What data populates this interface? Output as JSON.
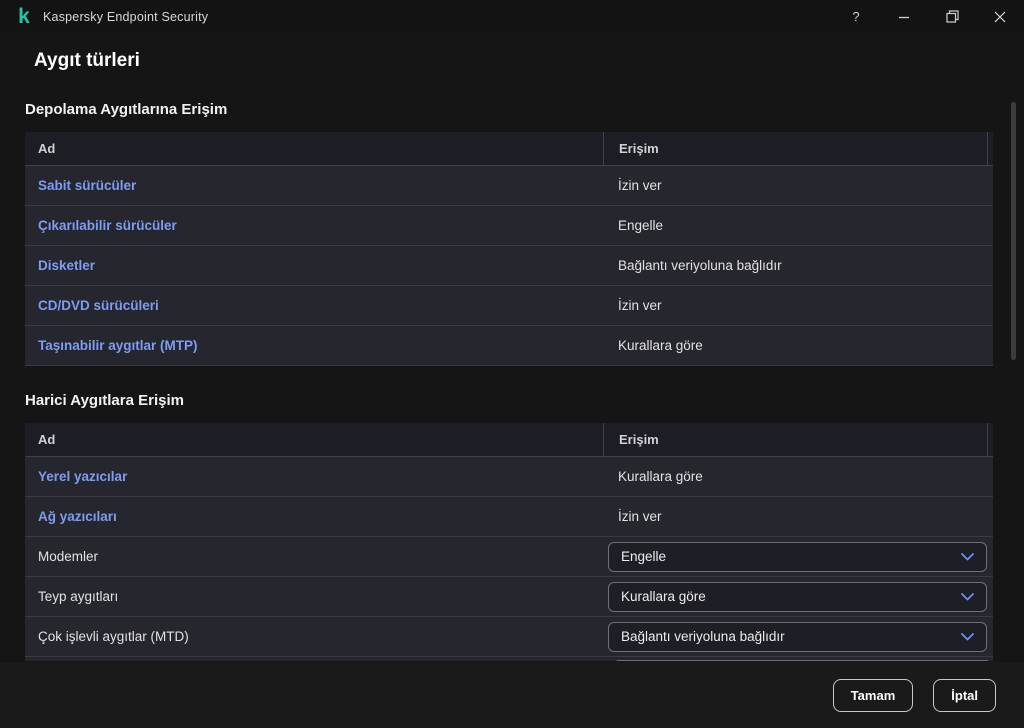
{
  "window": {
    "title": "Kaspersky Endpoint Security",
    "help_label": "?"
  },
  "page": {
    "title": "Aygıt türleri"
  },
  "sections": [
    {
      "heading": "Depolama Aygıtlarına Erişim",
      "columns": [
        "Ad",
        "Erişim"
      ],
      "rows": [
        {
          "name": "Sabit sürücüler",
          "access": "İzin ver",
          "name_is_link": true,
          "access_control": "text"
        },
        {
          "name": "Çıkarılabilir sürücüler",
          "access": "Engelle",
          "name_is_link": true,
          "access_control": "text"
        },
        {
          "name": "Disketler",
          "access": "Bağlantı veriyoluna bağlıdır",
          "name_is_link": true,
          "access_control": "text"
        },
        {
          "name": "CD/DVD sürücüleri",
          "access": "İzin ver",
          "name_is_link": true,
          "access_control": "text"
        },
        {
          "name": "Taşınabilir aygıtlar (MTP)",
          "access": "Kurallara göre",
          "name_is_link": true,
          "access_control": "text"
        }
      ],
      "partial_row_visible": false
    },
    {
      "heading": "Harici Aygıtlara Erişim",
      "columns": [
        "Ad",
        "Erişim"
      ],
      "rows": [
        {
          "name": "Yerel yazıcılar",
          "access": "Kurallara göre",
          "name_is_link": true,
          "access_control": "text"
        },
        {
          "name": "Ağ yazıcıları",
          "access": "İzin ver",
          "name_is_link": true,
          "access_control": "text"
        },
        {
          "name": "Modemler",
          "access": "Engelle",
          "name_is_link": false,
          "access_control": "dropdown"
        },
        {
          "name": "Teyp aygıtları",
          "access": "Kurallara göre",
          "name_is_link": false,
          "access_control": "dropdown"
        },
        {
          "name": "Çok işlevli aygıtlar (MTD)",
          "access": "Bağlantı veriyoluna bağlıdır",
          "name_is_link": false,
          "access_control": "dropdown"
        }
      ],
      "partial_row_visible": true
    }
  ],
  "footer": {
    "ok_label": "Tamam",
    "cancel_label": "İptal"
  },
  "colors": {
    "brand_teal": "#1fc7a5",
    "link_blue": "#7d9df2",
    "chevron_blue": "#6e8ef5",
    "row_bg": "#26262e",
    "header_row_bg": "#1d1d25"
  }
}
